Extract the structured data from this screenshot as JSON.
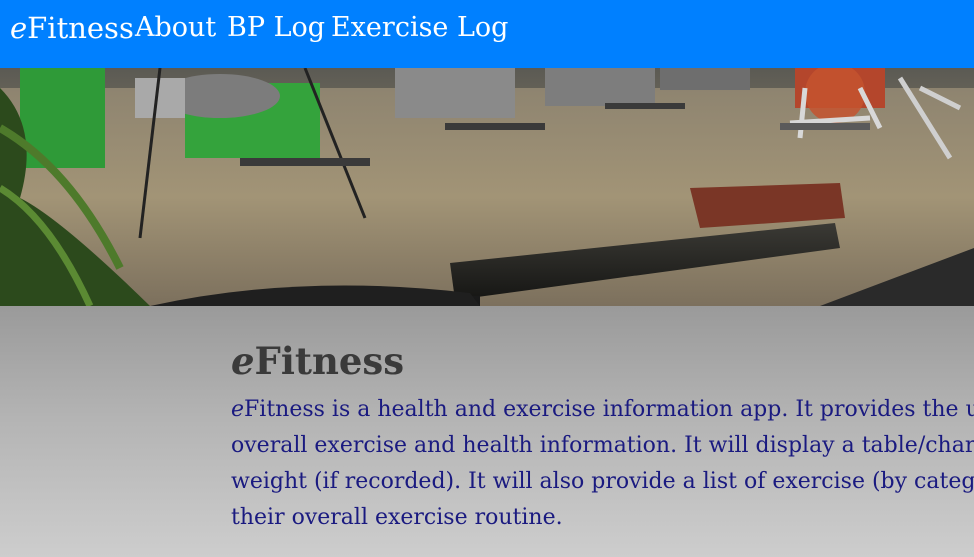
{
  "navbar": {
    "brand_prefix": "e",
    "brand_rest": "Fitness",
    "links": [
      "About",
      "BP Log",
      "Exercise Log"
    ],
    "background": "#0080ff"
  },
  "hero": {
    "description": "gym interior photo"
  },
  "main": {
    "title_prefix": "e",
    "title_rest": "Fitness",
    "paragraph_lines": [
      {
        "prefix": "e",
        "text": "Fitness is a health and exercise information app. It provides the user w"
      },
      {
        "prefix": "",
        "text": "overall exercise and health information. It will display a table/chart of"
      },
      {
        "prefix": "",
        "text": "weight (if recorded). It will also provide a list of exercise (by category, e"
      },
      {
        "prefix": "",
        "text": "their overall exercise routine."
      }
    ],
    "text_color": "#1a1a80",
    "title_color": "#3a3a3a"
  }
}
